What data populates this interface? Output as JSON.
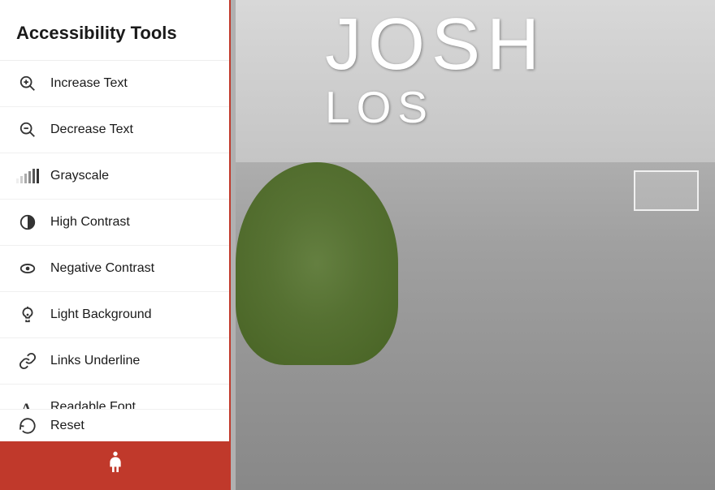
{
  "panel": {
    "title": "Accessibility Tools",
    "border_color": "#c0392b",
    "items": [
      {
        "id": "increase-text",
        "label": "Increase Text",
        "icon": "magnify-plus"
      },
      {
        "id": "decrease-text",
        "label": "Decrease Text",
        "icon": "magnify-minus"
      },
      {
        "id": "grayscale",
        "label": "Grayscale",
        "icon": "grayscale-bars"
      },
      {
        "id": "high-contrast",
        "label": "High Contrast",
        "icon": "half-circle"
      },
      {
        "id": "negative-contrast",
        "label": "Negative Contrast",
        "icon": "eye"
      },
      {
        "id": "light-background",
        "label": "Light Background",
        "icon": "bulb"
      },
      {
        "id": "links-underline",
        "label": "Links Underline",
        "icon": "link"
      },
      {
        "id": "readable-font",
        "label": "Readable Font",
        "icon": "letter-a"
      }
    ],
    "reset_label": "Reset",
    "bottom_button_icon": "accessibility-figure"
  },
  "hero": {
    "line1": "JOSH",
    "line2": "LOS"
  }
}
